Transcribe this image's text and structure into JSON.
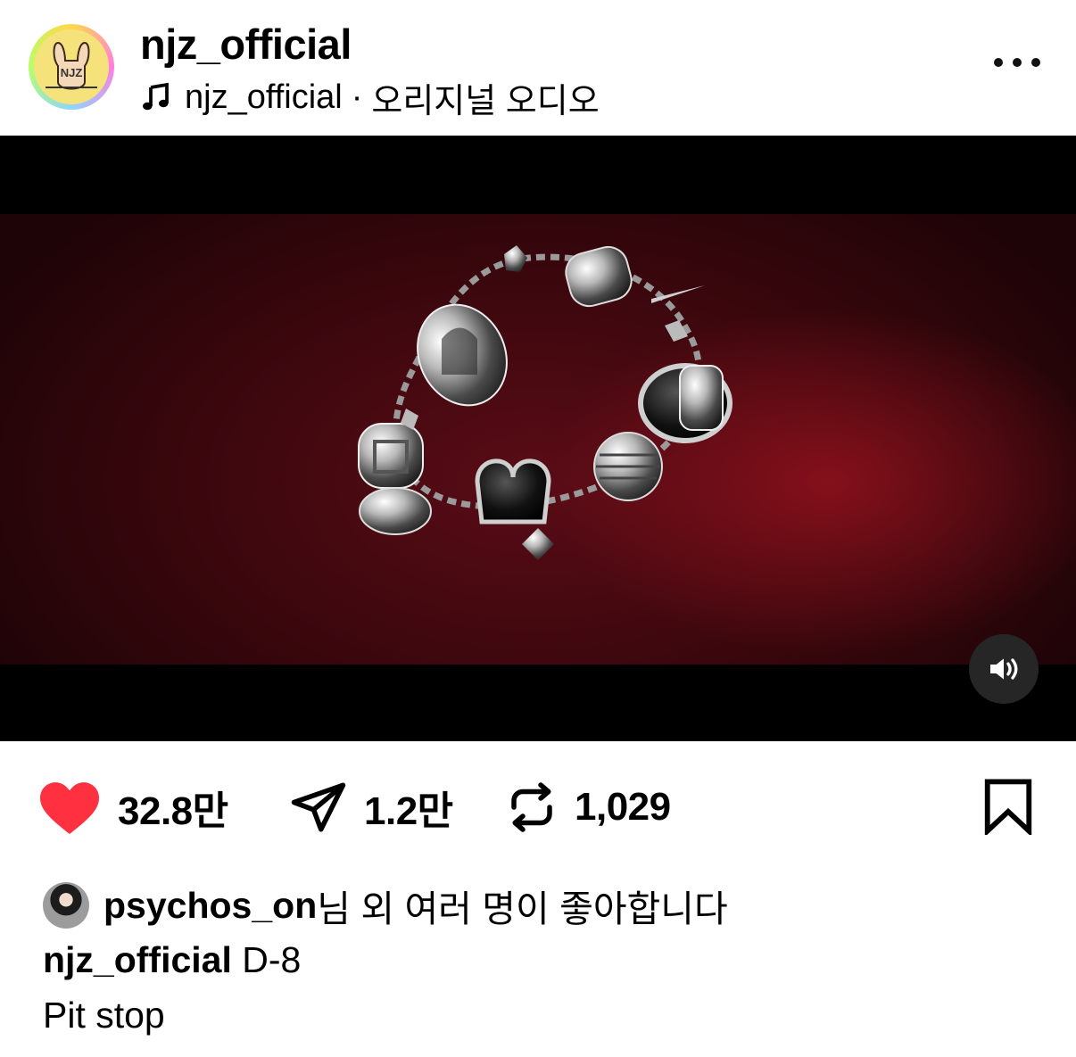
{
  "header": {
    "username": "njz_official",
    "audio_artist": "njz_official",
    "audio_separator": "·",
    "audio_label": "오리지널 오디오",
    "avatar_text": "NJZ",
    "more_icon": "more-horizontal-icon"
  },
  "video": {
    "mute_icon": "speaker-volume-icon",
    "scene_colors": {
      "background": "#3a070d",
      "accent": "#c41e32"
    }
  },
  "actions": {
    "like_count": "32.8만",
    "share_count": "1.2만",
    "repost_count": "1,029",
    "like_color": "#ff3040",
    "icons": [
      "heart-filled-icon",
      "send-icon",
      "repost-icon",
      "bookmark-icon"
    ]
  },
  "likes": {
    "liker": "psychos_on",
    "suffix": "님 외 여러 명이 좋아합니다"
  },
  "caption": {
    "username": "njz_official",
    "text": "D-8",
    "line2": "Pit stop"
  }
}
